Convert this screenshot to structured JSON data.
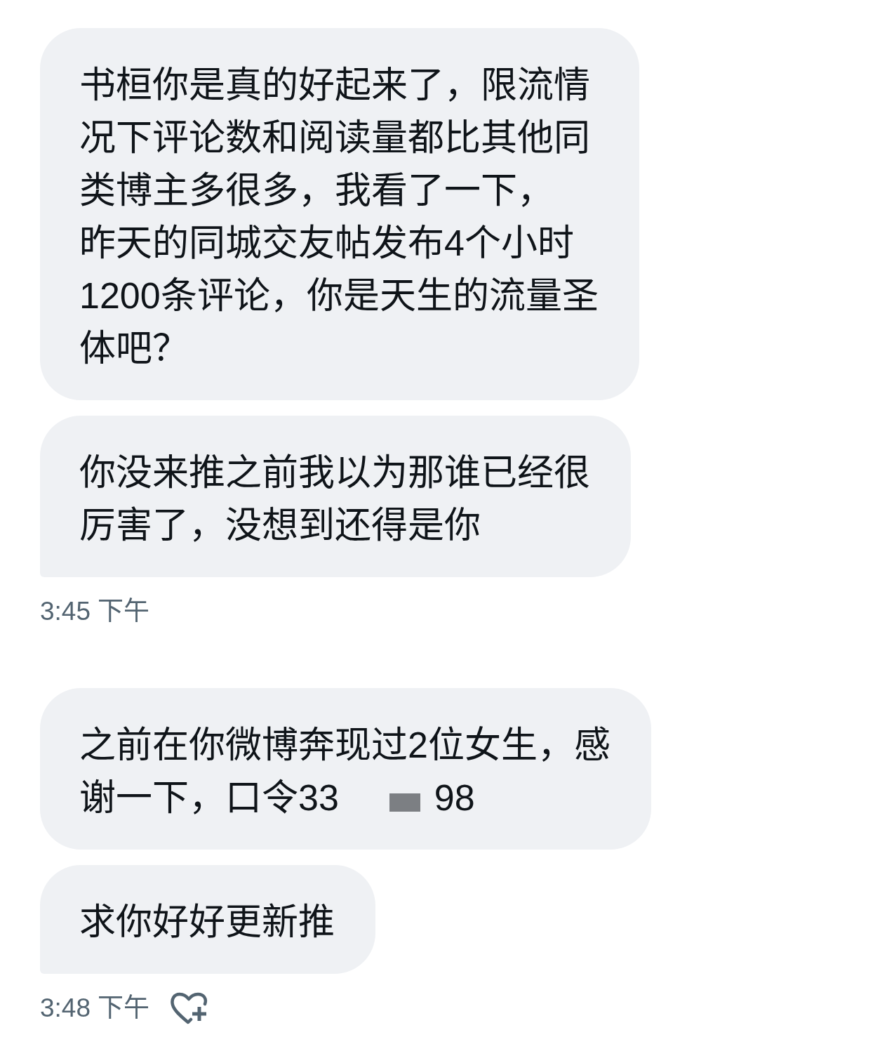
{
  "groups": [
    {
      "messages": [
        {
          "paragraphs": [
            {
              "segments": [
                {
                  "kind": "text",
                  "text": "书桓你是真的好起来了，限流情况下评论数和阅读量都比其他同类博主多很多，我看了一下，"
                }
              ]
            },
            {
              "segments": [
                {
                  "kind": "text",
                  "text": "昨天的同城交友帖发布4个小时1200条评论，你是天生的流量圣体吧？"
                }
              ]
            }
          ]
        },
        {
          "paragraphs": [
            {
              "segments": [
                {
                  "kind": "text",
                  "text": "你没来推之前我以为那谁已经很厉害了，没想到还得是你"
                }
              ]
            }
          ]
        }
      ],
      "time": "3:45 下午"
    },
    {
      "messages": [
        {
          "paragraphs": [
            {
              "segments": [
                {
                  "kind": "text",
                  "text": "之前在你微博奔现过2位女生，感"
                }
              ]
            },
            {
              "segments": [
                {
                  "kind": "text",
                  "text": "谢一下，口令33"
                },
                {
                  "kind": "redaction"
                },
                {
                  "kind": "text",
                  "text": "98"
                }
              ]
            }
          ]
        },
        {
          "paragraphs": [
            {
              "segments": [
                {
                  "kind": "text",
                  "text": "求你好好更新推"
                }
              ]
            }
          ]
        }
      ],
      "time": "3:48 下午",
      "react_button": true
    }
  ]
}
